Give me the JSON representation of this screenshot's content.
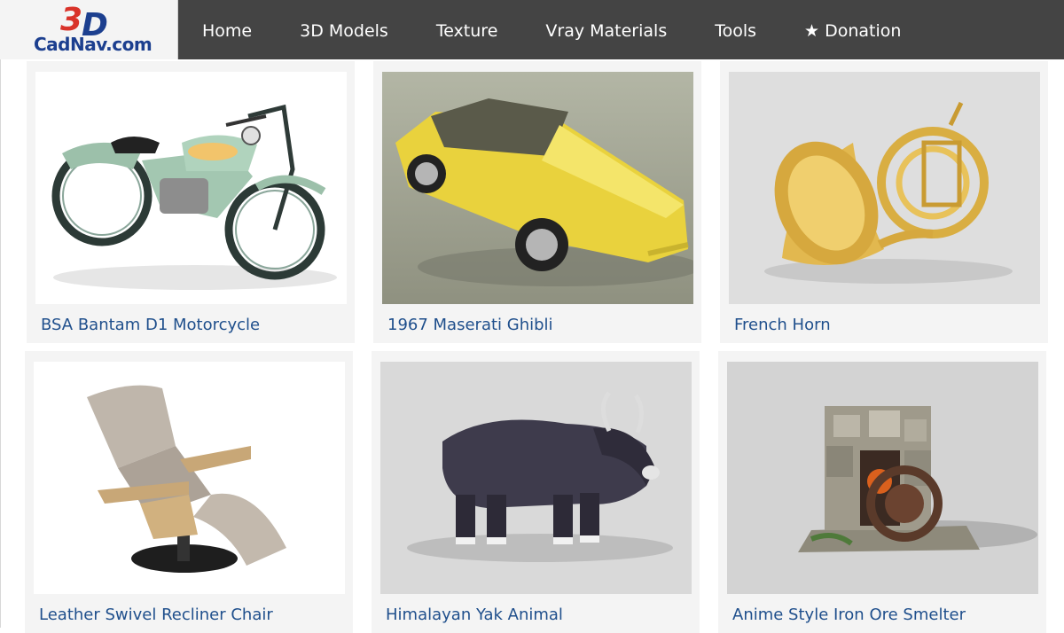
{
  "logo": {
    "mark_3": "3",
    "mark_d": "D",
    "text": "CadNav.com"
  },
  "nav": {
    "items": [
      {
        "label": "Home",
        "icon": ""
      },
      {
        "label": "3D Models",
        "icon": ""
      },
      {
        "label": "Texture",
        "icon": ""
      },
      {
        "label": "Vray Materials",
        "icon": ""
      },
      {
        "label": "Tools",
        "icon": ""
      },
      {
        "label": "Donation",
        "icon": "★"
      }
    ]
  },
  "models": [
    {
      "title": "BSA Bantam D1 Motorcycle",
      "image": "motorcycle"
    },
    {
      "title": "1967 Maserati Ghibli",
      "image": "yellow-car"
    },
    {
      "title": "French Horn",
      "image": "french-horn"
    },
    {
      "title": "Leather Swivel Recliner Chair",
      "image": "recliner-chair"
    },
    {
      "title": "Himalayan Yak Animal",
      "image": "yak"
    },
    {
      "title": "Anime Style Iron Ore Smelter",
      "image": "smelter"
    }
  ],
  "colors": {
    "nav_bg": "#444444",
    "link": "#1f4f8c",
    "card_bg": "#f4f4f4",
    "logo_red": "#d9332a",
    "logo_blue": "#1c3f8f"
  }
}
